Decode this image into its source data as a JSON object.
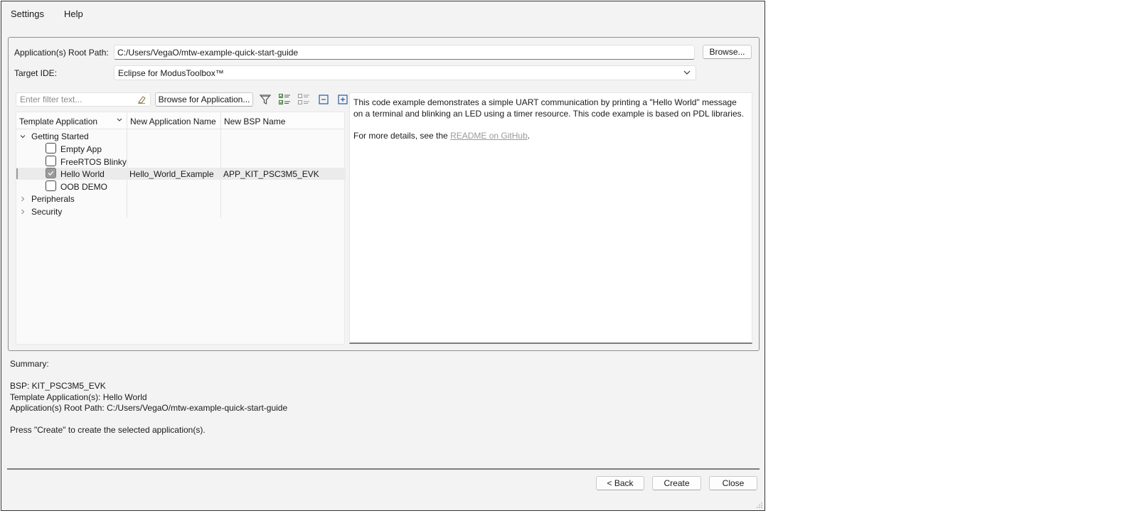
{
  "menu": {
    "settings": "Settings",
    "help": "Help"
  },
  "root_path": {
    "label": "Application(s) Root Path:",
    "value": "C:/Users/VegaO/mtw-example-quick-start-guide",
    "browse_label": "Browse..."
  },
  "target_ide": {
    "label": "Target IDE:",
    "selected": "Eclipse for ModusToolbox™"
  },
  "filter": {
    "placeholder": "Enter filter text...",
    "browse_apps_label": "Browse for Application..."
  },
  "toolbar_icons": [
    "filter-icon",
    "select-all-icon",
    "deselect-all-icon",
    "collapse-all-icon",
    "expand-all-icon"
  ],
  "table": {
    "columns": [
      "Template Application",
      "New Application Name",
      "New BSP Name"
    ],
    "groups": [
      {
        "name": "Getting Started",
        "expanded": true
      },
      {
        "name": "Peripherals",
        "expanded": false
      },
      {
        "name": "Security",
        "expanded": false
      }
    ],
    "items": [
      {
        "name": "Empty App",
        "checked": false,
        "app_name": "",
        "bsp_name": ""
      },
      {
        "name": "FreeRTOS Blinky",
        "checked": false,
        "app_name": "",
        "bsp_name": ""
      },
      {
        "name": "Hello World",
        "checked": true,
        "app_name": "Hello_World_Example",
        "bsp_name": "APP_KIT_PSC3M5_EVK"
      },
      {
        "name": "OOB DEMO",
        "checked": false,
        "app_name": "",
        "bsp_name": ""
      }
    ]
  },
  "description": {
    "text": "This code example demonstrates a simple UART communication by printing a \"Hello World\" message on a terminal and blinking an LED using a timer resource. This code example is based on PDL libraries.",
    "more_prefix": "For more details, see the ",
    "link_text": "README on GitHub",
    "more_suffix": "."
  },
  "summary": {
    "heading": "Summary:",
    "bsp": "BSP: KIT_PSC3M5_EVK",
    "templates": "Template Application(s): Hello World",
    "root_path": "Application(s) Root Path: C:/Users/VegaO/mtw-example-quick-start-guide",
    "instruction": "Press \"Create\" to create the selected application(s)."
  },
  "buttons": {
    "back": "< Back",
    "create": "Create",
    "close": "Close"
  },
  "colors": {
    "window_bg": "#f3f3f3",
    "checked_fill": "#9a9a9a",
    "link": "#9a9a9a"
  }
}
